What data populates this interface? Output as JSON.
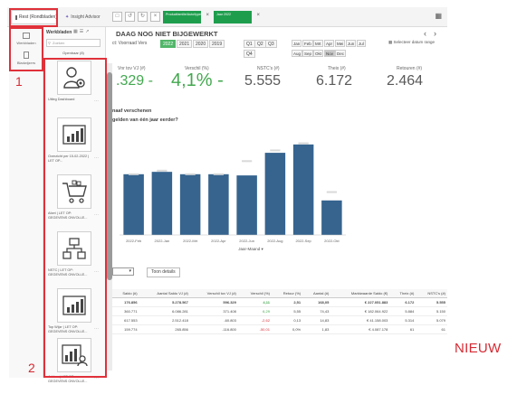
{
  "toolbar": {
    "assets_label": "Rest (Rondbladen)",
    "insight_label": "Insight Advisor",
    "chips": [
      {
        "label": "Productfamilie/Auto/type"
      },
      {
        "label": "Jaar 2022"
      }
    ]
  },
  "annotations": {
    "one": "1",
    "two": "2",
    "nieuw": "NIEUW"
  },
  "rail": {
    "items": [
      {
        "label": "Werkbladen",
        "icon": "sheets-icon"
      },
      {
        "label": "Bladwijzers",
        "icon": "bookmark-icon"
      }
    ]
  },
  "panel": {
    "title": "Werkbladen",
    "search_placeholder": "Zoeken",
    "subtitle": "Openbaar (8)",
    "sheets": [
      {
        "label": "Uitleg Dashboard",
        "icon": "person-gear-icon"
      },
      {
        "label": "Overzicht per 15-02-2022 | LET OP...",
        "icon": "bar-chart-icon"
      },
      {
        "label": "Afzet | LET OP: GEGEVENS ONVOLLE...",
        "icon": "cart-icon"
      },
      {
        "label": "NSTC | LET OP: GEGEVENS ONVOLLE...",
        "icon": "hierarchy-icon"
      },
      {
        "label": "Top Wijzr | LET OP: GEGEVENS ONVOLLE...",
        "icon": "bar-chart-icon"
      },
      {
        "label": "Ad hoc | LET OP: GEGEVENS ONVOLLE...",
        "icon": "chart-person-icon"
      }
    ]
  },
  "main": {
    "title": "DAAG NOG NIET BIJGEWERKT",
    "filter_label": "ct: Voorraad Vers",
    "years": [
      "2022",
      "2021",
      "2020",
      "2019"
    ],
    "selected_year": "2022",
    "quarters": [
      "Q1",
      "Q2",
      "Q3",
      "Q4"
    ],
    "months": [
      "Jan",
      "Feb",
      "Mrt",
      "Apr",
      "Mei",
      "Jun",
      "Jul",
      "Aug",
      "Sep",
      "Okt",
      "Nov",
      "Dec"
    ],
    "selected_month": "Nov",
    "range_label": "Selecteer datum range",
    "kpis": [
      {
        "label": "Vnr tov VJ (#)",
        "value": ".329 -",
        "green": true
      },
      {
        "label": "Verschil (%)",
        "value": "4,1% -",
        "green": true
      },
      {
        "label": "NSTC's (#)",
        "value": "5.555",
        "green": false
      },
      {
        "label": "Theix (#)",
        "value": "6.172",
        "green": false
      },
      {
        "label": "Retouren (#)",
        "value": "2.464",
        "green": false
      }
    ],
    "section_title": "naaf verschenen",
    "section_sub": "gelden van één jaar eerder?",
    "dropdown_label": "",
    "toon_label": "Toon details"
  },
  "chart_data": {
    "type": "bar",
    "categories": [
      "2022-Feb",
      "2022-Jan",
      "2022-Mrt",
      "2022-Apr",
      "2022-Jun",
      "2022-Aug",
      "2022-Sep",
      "2022-Okt"
    ],
    "values": [
      5.1,
      5.3,
      5.1,
      5.1,
      5.0,
      6.9,
      7.6,
      2.9
    ],
    "reference": [
      5.1,
      5.4,
      5.1,
      5.1,
      6.2,
      7.1,
      7.7,
      3.6
    ],
    "ylim": [
      0,
      8.5
    ],
    "xlabel": "Jaar-Maand",
    "colors": {
      "bar": "#36648f",
      "reference": "#d9d9d9"
    }
  },
  "table": {
    "headers": [
      "Saldo (#)",
      "Aantal Saldo VJ (#)",
      "Verschil tov VJ (#)",
      "Verschil (%)",
      "Retour (%)",
      "Aantal (#)",
      "Marktwaarde Saldo (€)",
      "Theix (#)",
      "NSTC's (#)"
    ],
    "rows": [
      {
        "total": true,
        "cells": [
          "176.856",
          "5.278.567",
          "596.329",
          "4,11",
          "2,51",
          "168,05",
          "€ 227.051.883",
          "6.172",
          "5.555"
        ]
      },
      {
        "total": false,
        "cells": [
          "360.771",
          "6.086.281",
          "371.408",
          "6,29",
          "5,55",
          "74,43",
          "€ 182.064.922",
          "5.884",
          "5.150"
        ]
      },
      {
        "total": false,
        "cells": [
          "617.553",
          "2.512.418",
          "-60.803",
          "-2,62",
          "0,13",
          "14,83",
          "€ 41.158.003",
          "5.314",
          "5.079"
        ]
      },
      {
        "total": false,
        "cells": [
          "159.774",
          "265.856",
          "-116.800",
          "-50,01",
          "0,0%",
          "1,83",
          "€ 4.087.178",
          "61",
          "61"
        ]
      }
    ]
  }
}
